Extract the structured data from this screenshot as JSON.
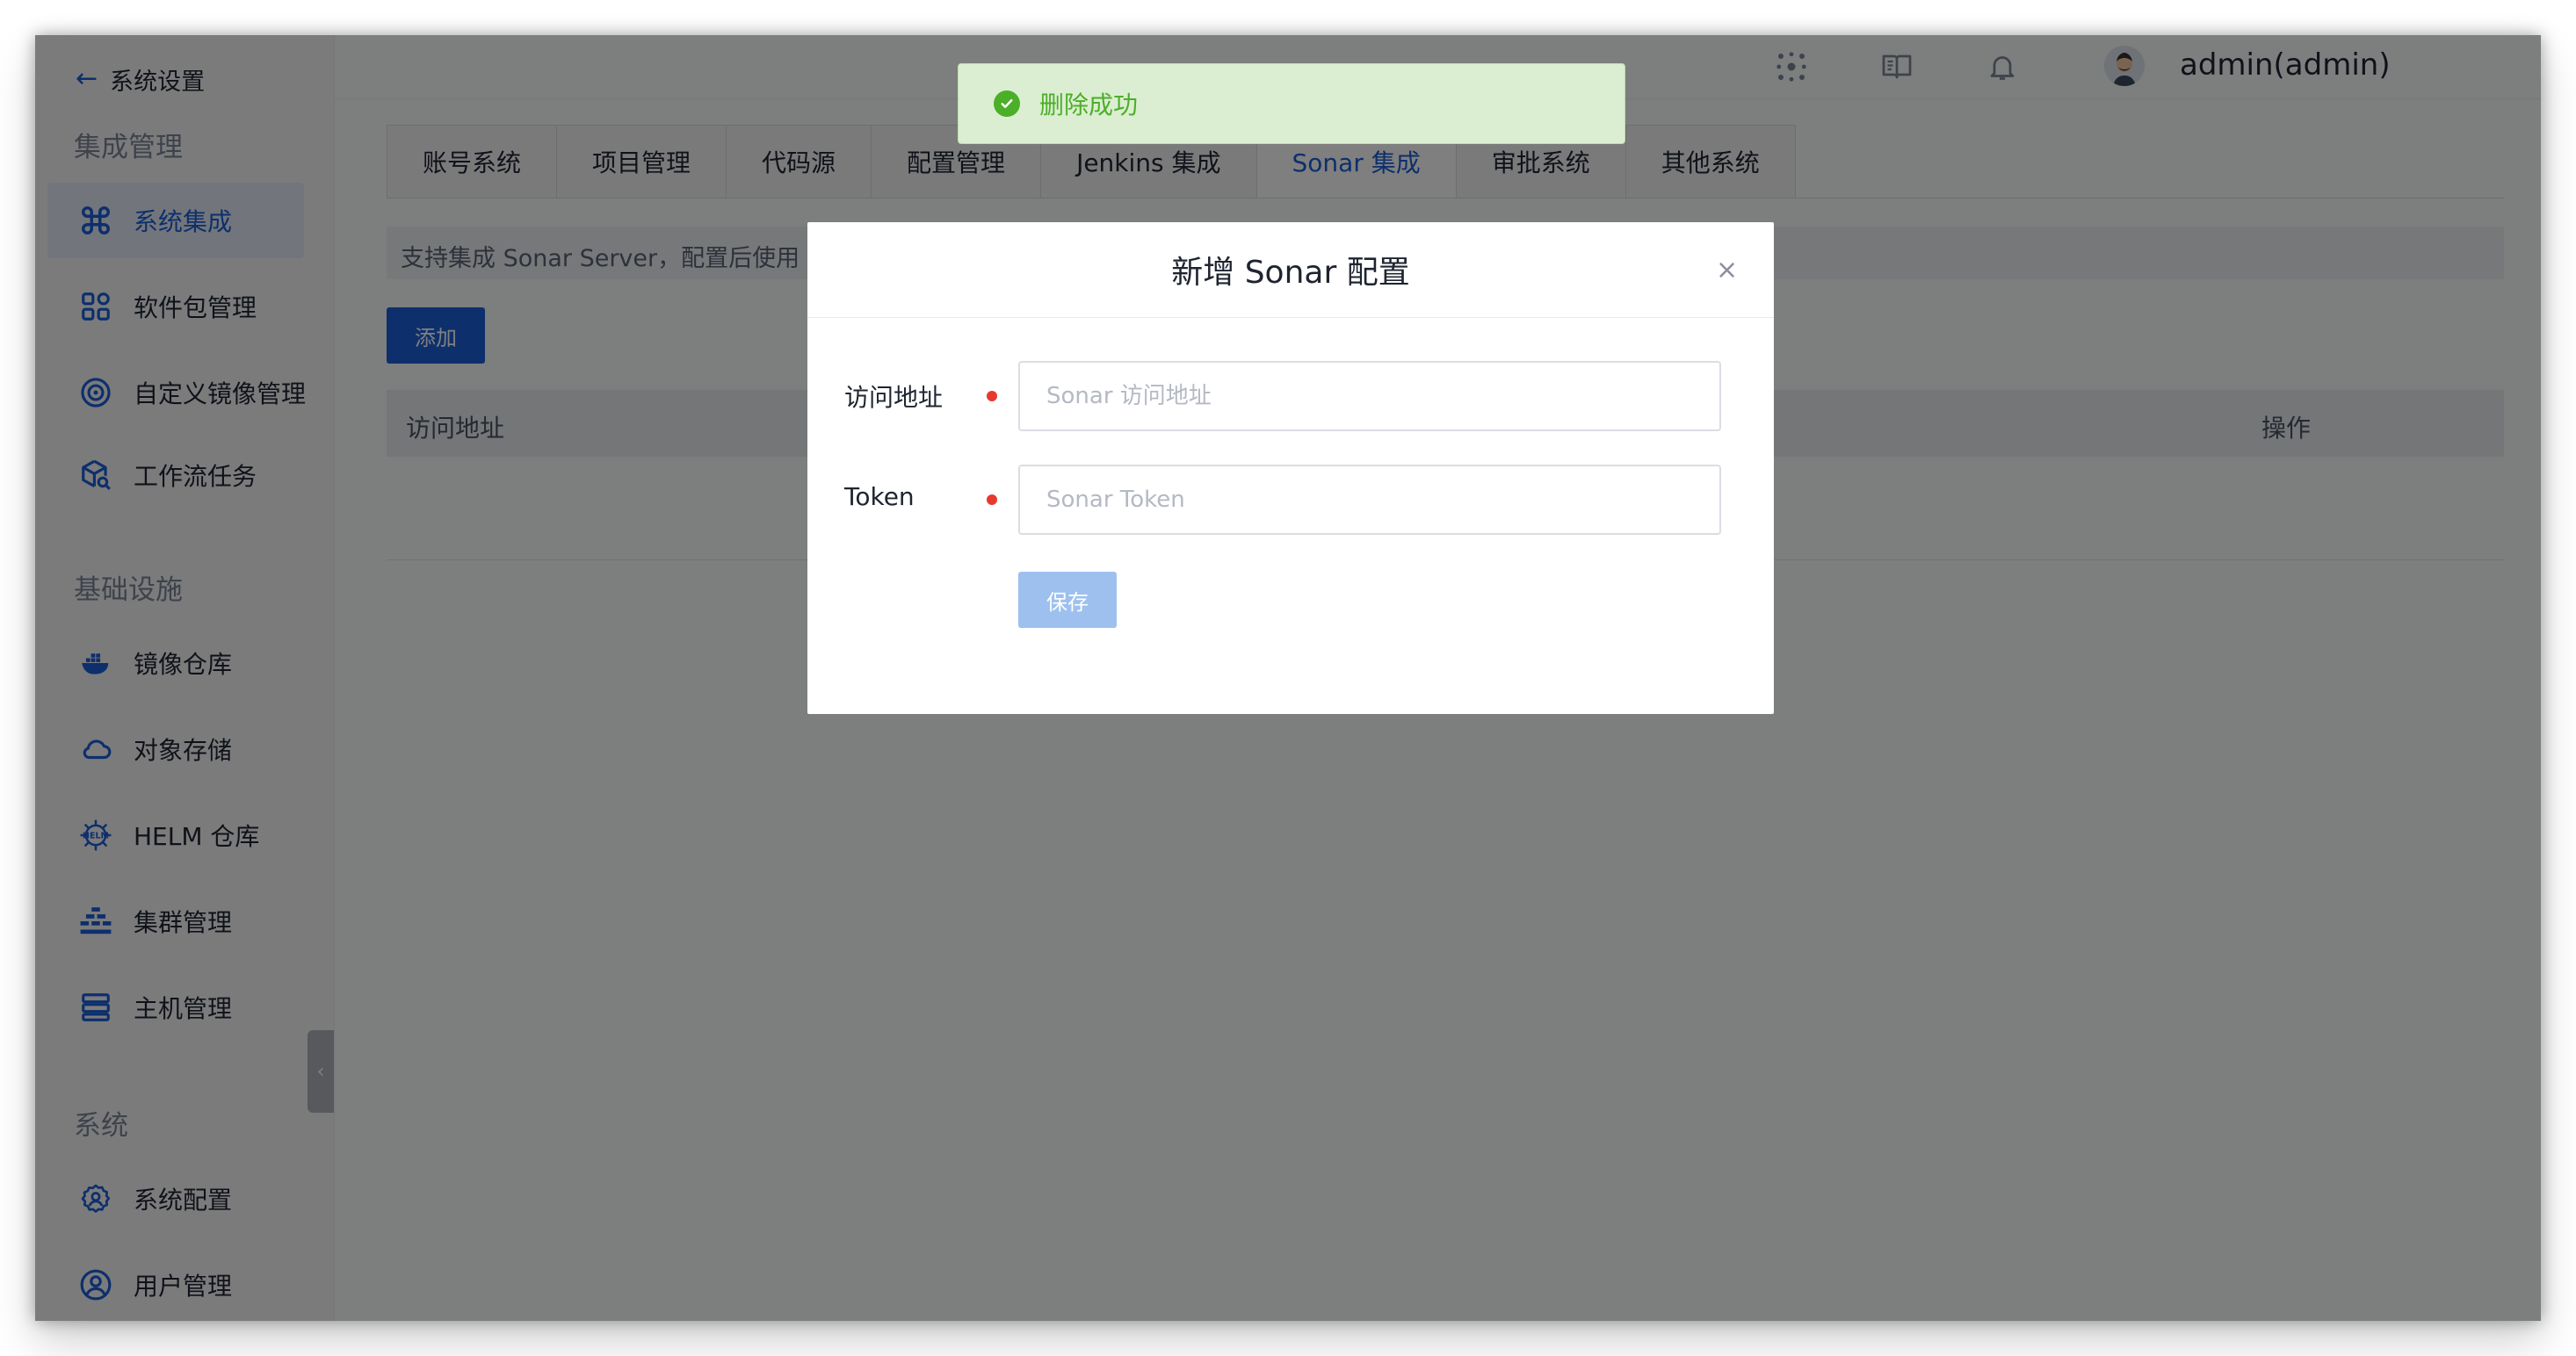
{
  "sidebar": {
    "back_label": "系统设置",
    "sections": {
      "integration": "集成管理",
      "infra": "基础设施",
      "system": "系统"
    },
    "items": [
      {
        "label": "系统集成",
        "icon": "command-icon",
        "active": true
      },
      {
        "label": "软件包管理",
        "icon": "grid-icon"
      },
      {
        "label": "自定义镜像管理",
        "icon": "disc-icon"
      },
      {
        "label": "工作流任务",
        "icon": "cube-search-icon"
      },
      {
        "label": "镜像仓库",
        "icon": "docker-icon"
      },
      {
        "label": "对象存储",
        "icon": "cloud-icon"
      },
      {
        "label": "HELM 仓库",
        "icon": "helm-icon"
      },
      {
        "label": "集群管理",
        "icon": "cluster-icon"
      },
      {
        "label": "主机管理",
        "icon": "server-icon"
      },
      {
        "label": "系统配置",
        "icon": "settings-user-icon"
      },
      {
        "label": "用户管理",
        "icon": "user-circle-icon"
      }
    ]
  },
  "header": {
    "username": "admin(admin)",
    "icons": [
      "network-icon",
      "book-icon",
      "bell-icon",
      "avatar",
      "more-icon"
    ]
  },
  "tabs": [
    "账号系统",
    "项目管理",
    "代码源",
    "配置管理",
    "Jenkins 集成",
    "Sonar 集成",
    "审批系统",
    "其他系统"
  ],
  "active_tab": "Sonar 集成",
  "main": {
    "info_text": "支持集成 Sonar Server，配置后使用 S",
    "add_button": "添加",
    "columns": {
      "address": "访问地址",
      "actions": "操作"
    }
  },
  "toast": {
    "message": "删除成功",
    "color": "#4caf28"
  },
  "modal": {
    "title": "新增 Sonar 配置",
    "close_symbol": "×",
    "fields": [
      {
        "label": "访问地址",
        "placeholder": "Sonar 访问地址",
        "value": "",
        "required": true
      },
      {
        "label": "Token",
        "placeholder": "Sonar Token",
        "value": "",
        "required": true
      }
    ],
    "save_button": "保存"
  },
  "colors": {
    "accent": "#1a5fd8",
    "required": "#e8392e",
    "success": "#4caf28"
  }
}
